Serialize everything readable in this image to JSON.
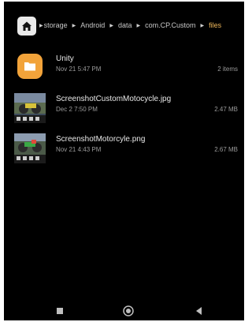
{
  "breadcrumb": {
    "home_icon": "home-icon",
    "segments": [
      {
        "label": "storage"
      },
      {
        "label": "Android"
      },
      {
        "label": "data"
      },
      {
        "label": "com.CP.Custom"
      },
      {
        "label": "files"
      }
    ],
    "separator": "▶",
    "current_color": "#f0b85a"
  },
  "files": [
    {
      "name": "Unity",
      "date": "Nov 21 5:47 PM",
      "meta": "2 items",
      "kind": "folder",
      "icon": "folder-icon"
    },
    {
      "name": "ScreenshotCustomMotocycle.jpg",
      "date": "Dec 2 7:50 PM",
      "meta": "2.47 MB",
      "kind": "image",
      "icon": "image-thumbnail"
    },
    {
      "name": "ScreenshotMotorcyle.png",
      "date": "Nov 21 4:43 PM",
      "meta": "2.67 MB",
      "kind": "image",
      "icon": "image-thumbnail"
    }
  ],
  "navigation": {
    "back_icon": "back-icon",
    "home_icon": "home-circle-icon",
    "recent_icon": "recent-apps-icon"
  },
  "colors": {
    "background": "#000000",
    "folder_accent": "#f2a33a",
    "text_primary": "#e8e8e8",
    "text_secondary": "#9a9a9a"
  }
}
